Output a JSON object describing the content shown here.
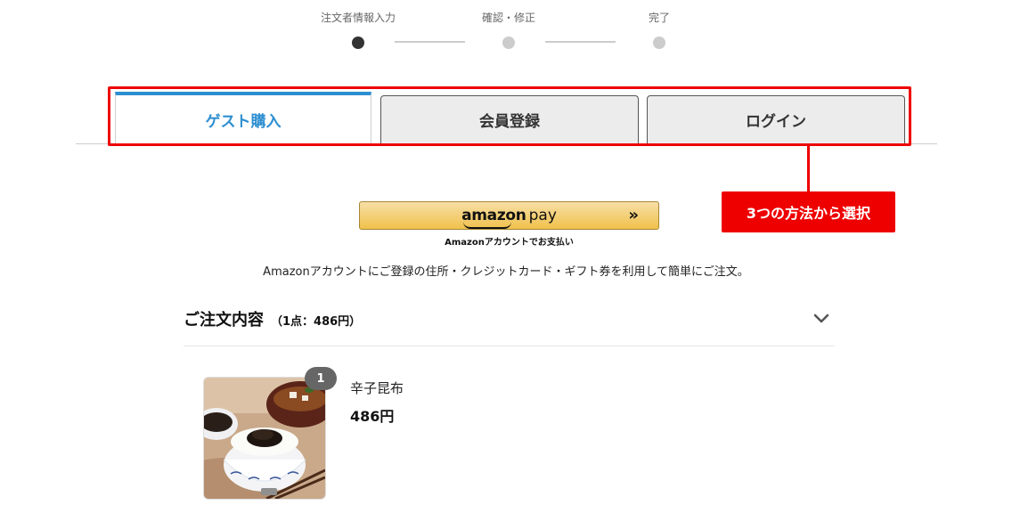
{
  "steps": [
    {
      "label": "注文者情報入力",
      "active": true
    },
    {
      "label": "確認・修正",
      "active": false
    },
    {
      "label": "完了",
      "active": false
    }
  ],
  "tabs": [
    {
      "label": "ゲスト購入",
      "active": true
    },
    {
      "label": "会員登録",
      "active": false
    },
    {
      "label": "ログイン",
      "active": false
    }
  ],
  "annotation": {
    "callout_text": "3つの方法から選択",
    "color": "#ee0000"
  },
  "amazon_pay": {
    "logo_word": "amazon",
    "logo_pay": "pay",
    "arrows": "»",
    "sub_label": "Amazonアカウントでお支払い",
    "description": "Amazonアカウントにご登録の住所・クレジットカード・ギフト券を利用して簡単にご注文。"
  },
  "order": {
    "title": "ご注文内容",
    "count_label": "（1点：486円）",
    "items": [
      {
        "quantity": "1",
        "name": "辛子昆布",
        "price": "486円"
      }
    ]
  },
  "colors": {
    "accent_blue": "#2b8fd1",
    "amazon_gold": "#f0c14b",
    "badge_gray": "#666666"
  },
  "icons": {
    "collapse": "chevron-down-icon",
    "forward": "double-chevron-right-icon"
  }
}
